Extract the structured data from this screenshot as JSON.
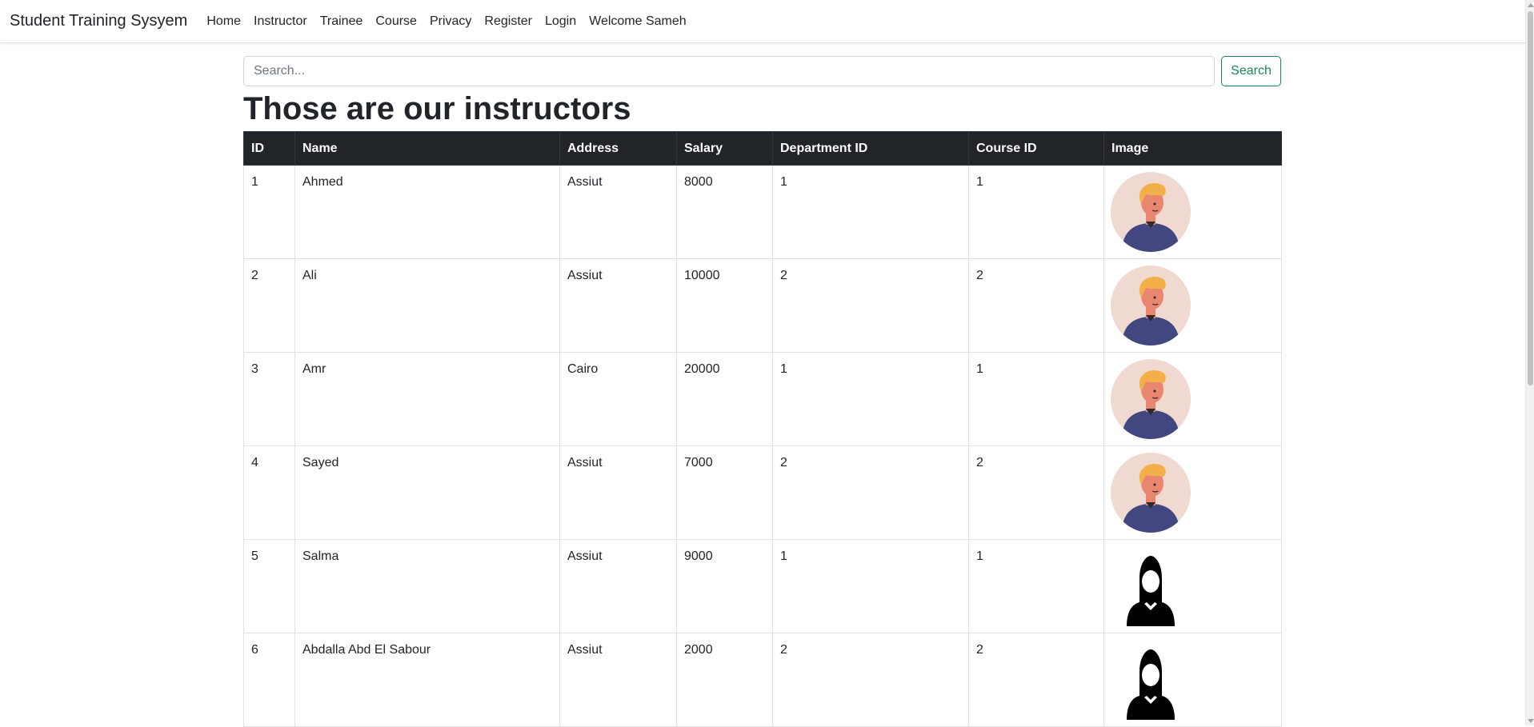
{
  "navbar": {
    "brand": "Student Training Sysyem",
    "links": [
      "Home",
      "Instructor",
      "Trainee",
      "Course",
      "Privacy",
      "Register",
      "Login",
      "Welcome Sameh"
    ]
  },
  "search": {
    "placeholder": "Search...",
    "value": "",
    "button_label": "Search"
  },
  "page_title": "Those are our instructors",
  "table": {
    "columns": [
      "ID",
      "Name",
      "Address",
      "Salary",
      "Department ID",
      "Course ID",
      "Image"
    ],
    "rows": [
      {
        "id": "1",
        "name": "Ahmed",
        "address": "Assiut",
        "salary": "8000",
        "department_id": "1",
        "course_id": "1",
        "image": "male-avatar"
      },
      {
        "id": "2",
        "name": "Ali",
        "address": "Assiut",
        "salary": "10000",
        "department_id": "2",
        "course_id": "2",
        "image": "male-avatar"
      },
      {
        "id": "3",
        "name": "Amr",
        "address": "Cairo",
        "salary": "20000",
        "department_id": "1",
        "course_id": "1",
        "image": "male-avatar"
      },
      {
        "id": "4",
        "name": "Sayed",
        "address": "Assiut",
        "salary": "7000",
        "department_id": "2",
        "course_id": "2",
        "image": "male-avatar"
      },
      {
        "id": "5",
        "name": "Salma",
        "address": "Assiut",
        "salary": "9000",
        "department_id": "1",
        "course_id": "1",
        "image": "female-silhouette"
      },
      {
        "id": "6",
        "name": "Abdalla Abd El Sabour",
        "address": "Assiut",
        "salary": "2000",
        "department_id": "2",
        "course_id": "2",
        "image": "female-silhouette"
      }
    ]
  },
  "colors": {
    "header_bg": "#212529",
    "success": "#198754",
    "avatar_bg": "#efd9d1",
    "shirt": "#434780",
    "hair": "#f3b04a",
    "skin": "#e9866f"
  }
}
